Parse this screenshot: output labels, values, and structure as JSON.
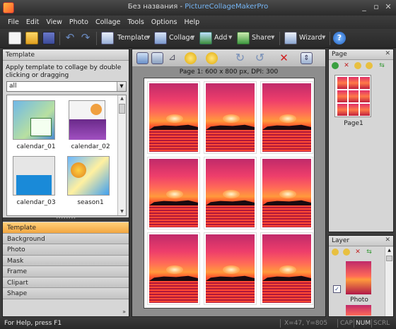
{
  "window": {
    "title_main": "Без названия",
    "title_sep": " - ",
    "title_app": "PictureCollageMakerPro"
  },
  "menu": [
    "File",
    "Edit",
    "View",
    "Photo",
    "Collage",
    "Tools",
    "Options",
    "Help"
  ],
  "toolbar": {
    "template": "Template",
    "collage": "Collage",
    "add": "Add",
    "share": "Share",
    "wizard": "Wizard"
  },
  "left": {
    "header": "Template",
    "instruction": "Apply template to collage by double clicking or dragging",
    "filter": "all",
    "templates": [
      "calendar_01",
      "calendar_02",
      "calendar_03",
      "season1"
    ],
    "tabs": [
      "Template",
      "Background",
      "Photo",
      "Mask",
      "Frame",
      "Clipart",
      "Shape"
    ],
    "more": "»"
  },
  "canvas": {
    "page_info": "Page 1: 600 x 800 px, DPI: 300",
    "photo_count": 9
  },
  "page_panel": {
    "header": "Page",
    "close": "✕",
    "thumb_label": "Page1"
  },
  "layer_panel": {
    "header": "Layer",
    "close": "✕",
    "layer_label": "Photo",
    "checked": true
  },
  "status": {
    "help": "For Help, press F1",
    "coords": "X=47, Y=805",
    "cap": "CAP",
    "num": "NUM",
    "scrl": "SCRL"
  },
  "colors": {
    "accent": "#76b6f5",
    "active_tab": "#f2a640"
  }
}
